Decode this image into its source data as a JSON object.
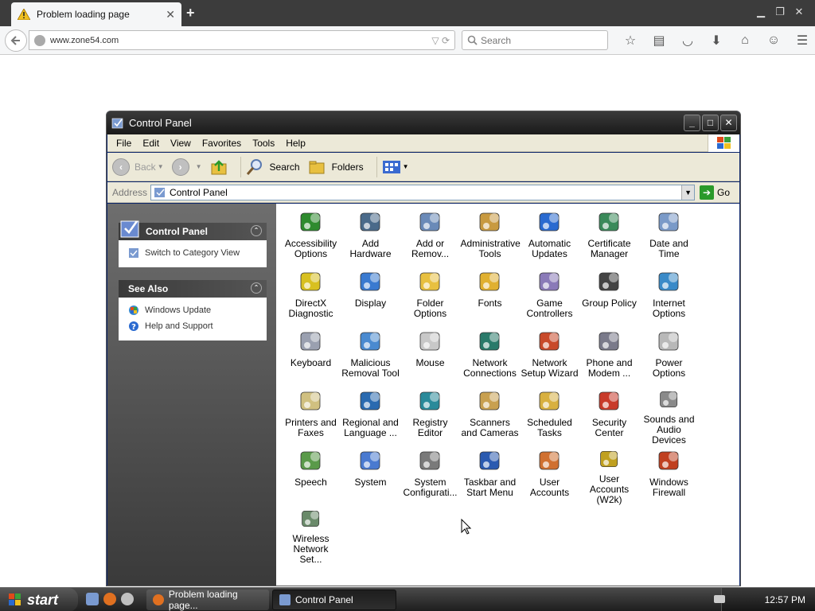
{
  "browser": {
    "tab_title": "Problem loading page",
    "url": "www.zone54.com",
    "search_placeholder": "Search"
  },
  "window": {
    "title": "Control Panel",
    "menu": [
      "File",
      "Edit",
      "View",
      "Favorites",
      "Tools",
      "Help"
    ],
    "toolbar": {
      "back": "Back",
      "search": "Search",
      "folders": "Folders"
    },
    "address": {
      "label": "Address",
      "value": "Control Panel",
      "go": "Go"
    }
  },
  "sidebar": {
    "panel1": {
      "title": "Control Panel",
      "items": [
        "Switch to Category View"
      ]
    },
    "panel2": {
      "title": "See Also",
      "items": [
        "Windows Update",
        "Help and Support"
      ]
    }
  },
  "applets": [
    {
      "label": "Accessibility Options",
      "icon": "accessibility-icon",
      "color": "#2e8b2e"
    },
    {
      "label": "Add Hardware",
      "icon": "add-hardware-icon",
      "color": "#4a6a8a"
    },
    {
      "label": "Add or Remov...",
      "icon": "add-remove-programs-icon",
      "color": "#6a8ab8"
    },
    {
      "label": "Administrative Tools",
      "icon": "administrative-tools-icon",
      "color": "#c89a40"
    },
    {
      "label": "Automatic Updates",
      "icon": "automatic-updates-icon",
      "color": "#2a6ad0"
    },
    {
      "label": "Certificate Manager",
      "icon": "certificate-icon",
      "color": "#3a8a5a"
    },
    {
      "label": "Date and Time",
      "icon": "clock-icon",
      "color": "#7a9ac8"
    },
    {
      "label": "DirectX Diagnostic",
      "icon": "directx-icon",
      "color": "#d8c020"
    },
    {
      "label": "Display",
      "icon": "display-icon",
      "color": "#3a7ad0"
    },
    {
      "label": "Folder Options",
      "icon": "folder-options-icon",
      "color": "#e8c040"
    },
    {
      "label": "Fonts",
      "icon": "fonts-folder-icon",
      "color": "#e0b030"
    },
    {
      "label": "Game Controllers",
      "icon": "gamepad-icon",
      "color": "#8a7ab8"
    },
    {
      "label": "Group Policy",
      "icon": "group-policy-icon",
      "color": "#444444"
    },
    {
      "label": "Internet Options",
      "icon": "internet-options-icon",
      "color": "#3a8ac8"
    },
    {
      "label": "Keyboard",
      "icon": "keyboard-icon",
      "color": "#9aa0b0"
    },
    {
      "label": "Malicious Removal Tool",
      "icon": "malicious-removal-icon",
      "color": "#4a8ad0"
    },
    {
      "label": "Mouse",
      "icon": "mouse-icon",
      "color": "#c8c8c8"
    },
    {
      "label": "Network Connections",
      "icon": "network-connections-icon",
      "color": "#2a7a6a"
    },
    {
      "label": "Network Setup Wizard",
      "icon": "network-setup-icon",
      "color": "#c84a2a"
    },
    {
      "label": "Phone and Modem ...",
      "icon": "phone-modem-icon",
      "color": "#7a7a8a"
    },
    {
      "label": "Power Options",
      "icon": "power-options-icon",
      "color": "#b8b8b8"
    },
    {
      "label": "Printers and Faxes",
      "icon": "printer-icon",
      "color": "#d0c080"
    },
    {
      "label": "Regional and Language ...",
      "icon": "globe-icon",
      "color": "#2a6ab0"
    },
    {
      "label": "Registry Editor",
      "icon": "registry-editor-icon",
      "color": "#2a8a9a"
    },
    {
      "label": "Scanners and Cameras",
      "icon": "scanner-camera-icon",
      "color": "#c8a050"
    },
    {
      "label": "Scheduled Tasks",
      "icon": "scheduled-tasks-icon",
      "color": "#d8b040"
    },
    {
      "label": "Security Center",
      "icon": "security-shield-icon",
      "color": "#c83a2a"
    },
    {
      "label": "Sounds and Audio Devices",
      "icon": "speaker-icon",
      "color": "#8a8a8a"
    },
    {
      "label": "Speech",
      "icon": "speech-icon",
      "color": "#5a9a4a"
    },
    {
      "label": "System",
      "icon": "system-icon",
      "color": "#4a7ad0"
    },
    {
      "label": "System Configurati...",
      "icon": "system-config-icon",
      "color": "#7a7a7a"
    },
    {
      "label": "Taskbar and Start Menu",
      "icon": "taskbar-icon",
      "color": "#2a5ab0"
    },
    {
      "label": "User Accounts",
      "icon": "user-accounts-icon",
      "color": "#d07030"
    },
    {
      "label": "User Accounts (W2k)",
      "icon": "user-accounts-w2k-icon",
      "color": "#c0a020"
    },
    {
      "label": "Windows Firewall",
      "icon": "firewall-icon",
      "color": "#c04020"
    },
    {
      "label": "Wireless Network Set...",
      "icon": "wireless-icon",
      "color": "#6a8a6a"
    }
  ],
  "taskbar": {
    "start": "start",
    "tasks": [
      "Problem loading page...",
      "Control Panel"
    ],
    "clock": "12:57 PM"
  },
  "colors": {
    "xp_panel_gray": "#4a4a4a",
    "menu_beige": "#ece9d8",
    "title_dark": "#1a1a1a"
  }
}
